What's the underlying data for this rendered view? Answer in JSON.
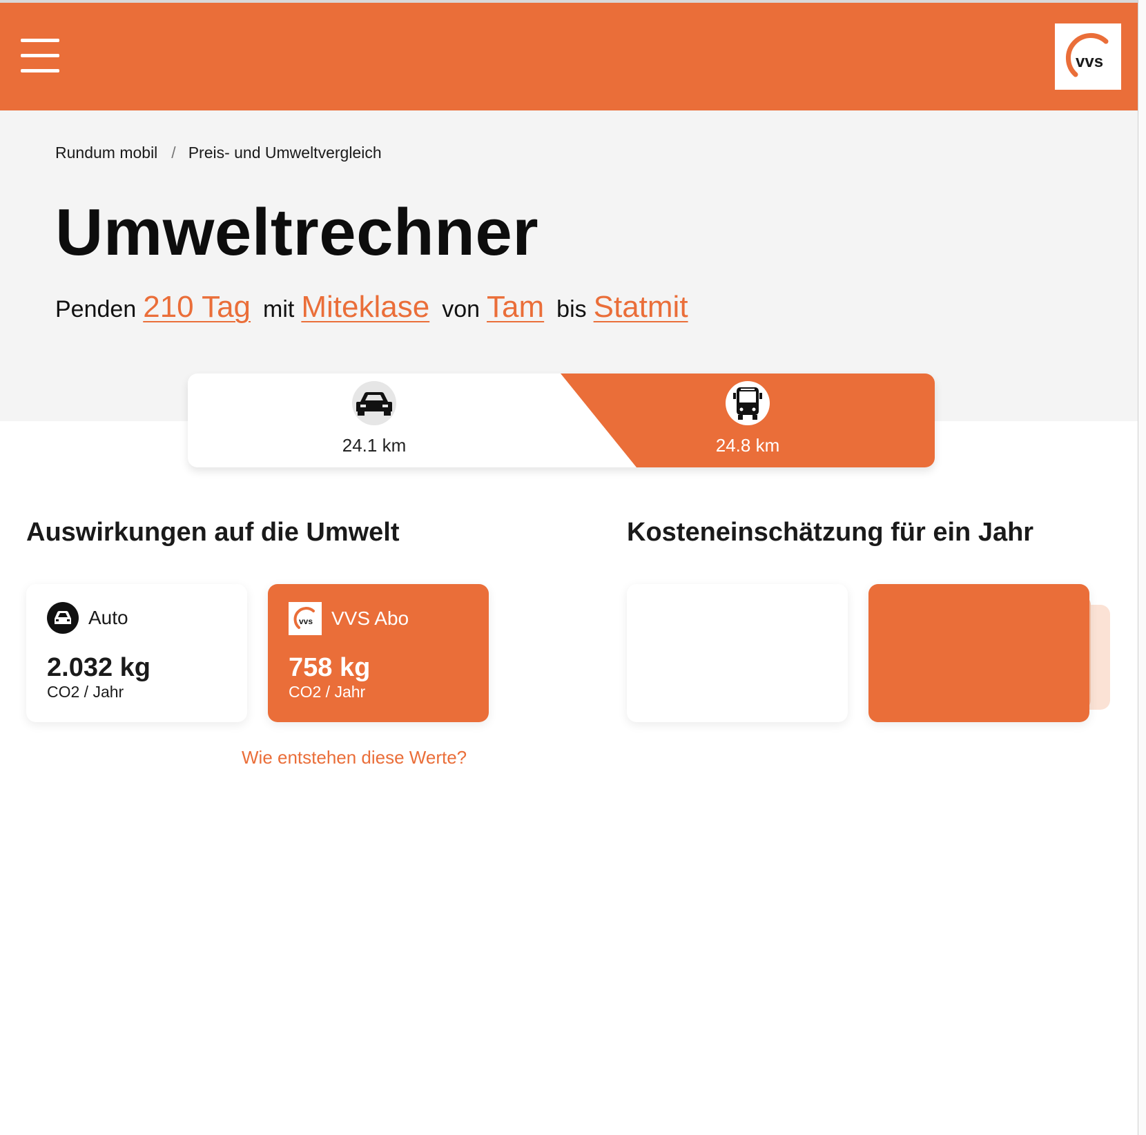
{
  "header": {
    "menu_icon": "hamburger-menu-icon",
    "logo_text": "vvs",
    "brand_color": "#ea6e39"
  },
  "breadcrumb": {
    "items": [
      {
        "label": "Rundum mobil"
      },
      {
        "label": "Preis- und Umweltvergleich"
      }
    ],
    "separator": "/"
  },
  "page_title": "Umweltrechner",
  "sentence": {
    "w1": "Penden",
    "days": "210 Tag",
    "w2": "mit",
    "vehicle_class": "Miteklase",
    "w3": "von",
    "from": "Tam",
    "w4": "bis",
    "to": "Statmit"
  },
  "modes": {
    "car": {
      "icon": "car-icon",
      "distance": "24.1 km"
    },
    "transit": {
      "icon": "bus-icon",
      "distance": "24.8 km",
      "selected": true
    }
  },
  "environment": {
    "heading": "Auswirkungen auf die Umwelt",
    "cards": [
      {
        "icon": "car-icon",
        "label": "Auto",
        "value": "2.032 kg",
        "unit": "CO2 / Jahr"
      },
      {
        "icon": "vvs-logo-icon",
        "label": "VVS Abo",
        "value": "758 kg",
        "unit": "CO2 / Jahr"
      }
    ],
    "info_link": "Wie entstehen diese Werte?"
  },
  "costs": {
    "heading": "Kosteneinschätzung für ein Jahr"
  }
}
